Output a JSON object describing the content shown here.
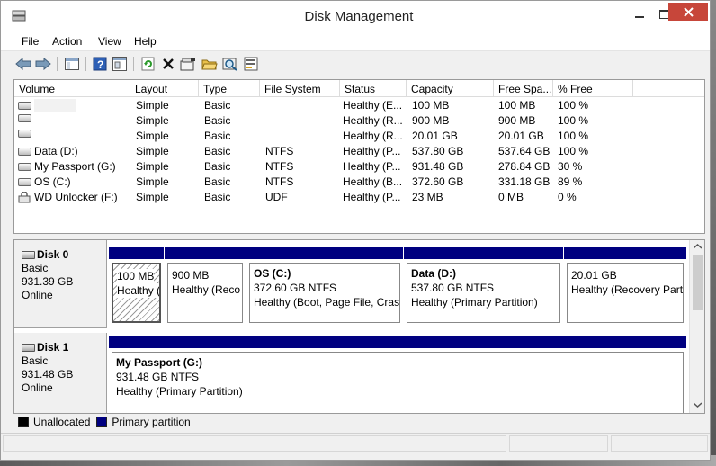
{
  "window": {
    "title": "Disk Management"
  },
  "menu": [
    "File",
    "Action",
    "View",
    "Help"
  ],
  "toolbar": {
    "icons": [
      "back-arrow-icon",
      "forward-arrow-icon",
      "console-tree-icon",
      "help-icon",
      "properties-icon",
      "refresh-icon",
      "delete-icon",
      "new-volume-icon",
      "open-folder-icon",
      "search-icon",
      "rescan-icon"
    ]
  },
  "volume_list": {
    "columns": [
      "Volume",
      "Layout",
      "Type",
      "File System",
      "Status",
      "Capacity",
      "Free Spa...",
      "% Free"
    ],
    "rows": [
      {
        "volume": "",
        "layout": "Simple",
        "type": "Basic",
        "fs": "",
        "status": "Healthy (E...",
        "capacity": "100 MB",
        "free": "100 MB",
        "pct": "100 %"
      },
      {
        "volume": "",
        "layout": "Simple",
        "type": "Basic",
        "fs": "",
        "status": "Healthy (R...",
        "capacity": "900 MB",
        "free": "900 MB",
        "pct": "100 %"
      },
      {
        "volume": "",
        "layout": "Simple",
        "type": "Basic",
        "fs": "",
        "status": "Healthy (R...",
        "capacity": "20.01 GB",
        "free": "20.01 GB",
        "pct": "100 %"
      },
      {
        "volume": "Data (D:)",
        "layout": "Simple",
        "type": "Basic",
        "fs": "NTFS",
        "status": "Healthy (P...",
        "capacity": "537.80 GB",
        "free": "537.64 GB",
        "pct": "100 %"
      },
      {
        "volume": "My Passport (G:)",
        "layout": "Simple",
        "type": "Basic",
        "fs": "NTFS",
        "status": "Healthy (P...",
        "capacity": "931.48 GB",
        "free": "278.84 GB",
        "pct": "30 %"
      },
      {
        "volume": "OS (C:)",
        "layout": "Simple",
        "type": "Basic",
        "fs": "NTFS",
        "status": "Healthy (B...",
        "capacity": "372.60 GB",
        "free": "331.18 GB",
        "pct": "89 %"
      },
      {
        "volume": "WD Unlocker (F:)",
        "layout": "Simple",
        "type": "Basic",
        "fs": "UDF",
        "status": "Healthy (P...",
        "capacity": "23 MB",
        "free": "0 MB",
        "pct": "0 %"
      }
    ]
  },
  "disks": [
    {
      "name": "Disk 0",
      "type": "Basic",
      "size": "931.39 GB",
      "state": "Online",
      "partitions": [
        {
          "name": "",
          "size": "100 MB",
          "status": "Healthy ("
        },
        {
          "name": "",
          "size": "900 MB",
          "status": "Healthy (Reco"
        },
        {
          "name": "OS  (C:)",
          "size": "372.60 GB NTFS",
          "status": "Healthy (Boot, Page File, Crash"
        },
        {
          "name": "Data  (D:)",
          "size": "537.80 GB NTFS",
          "status": "Healthy (Primary Partition)"
        },
        {
          "name": "",
          "size": "20.01 GB",
          "status": "Healthy (Recovery Parti"
        }
      ]
    },
    {
      "name": "Disk 1",
      "type": "Basic",
      "size": "931.48 GB",
      "state": "Online",
      "partitions": [
        {
          "name": "My Passport  (G:)",
          "size": "931.48 GB NTFS",
          "status": "Healthy (Primary Partition)"
        }
      ]
    }
  ],
  "legend": [
    {
      "label": "Unallocated",
      "color": "#000000"
    },
    {
      "label": "Primary partition",
      "color": "#000080"
    }
  ]
}
